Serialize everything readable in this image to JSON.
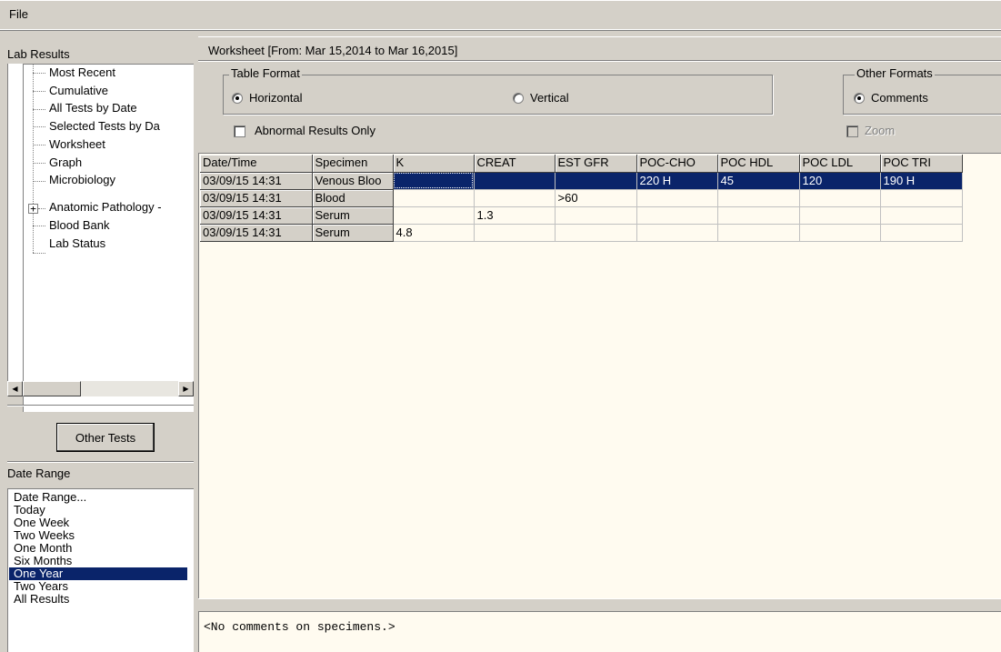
{
  "menu": {
    "file": "File"
  },
  "left": {
    "lab_results_title": "Lab Results",
    "tree": [
      {
        "label": "Most Recent"
      },
      {
        "label": "Cumulative"
      },
      {
        "label": "All Tests by Date"
      },
      {
        "label": "Selected Tests by Da"
      },
      {
        "label": "Worksheet"
      },
      {
        "label": "Graph"
      },
      {
        "label": "Microbiology"
      },
      {
        "label": "Anatomic Pathology -"
      },
      {
        "label": "Blood Bank"
      },
      {
        "label": "Lab Status"
      }
    ],
    "other_tests_label": "Other Tests",
    "date_range_title": "Date Range",
    "date_ranges": [
      "Date Range...",
      "Today",
      "One Week",
      "Two Weeks",
      "One Month",
      "Six Months",
      "One Year",
      "Two Years",
      "All Results"
    ],
    "selected_date_range": "One Year"
  },
  "worksheet": {
    "title": "Worksheet [From: Mar 15,2014 to Mar 16,2015]",
    "table_format": {
      "label": "Table Format",
      "horizontal": "Horizontal",
      "vertical": "Vertical",
      "selected": "Horizontal"
    },
    "other_formats": {
      "label": "Other Formats",
      "comments": "Comments",
      "selected": "Comments"
    },
    "abnormal_only": {
      "label": "Abnormal Results Only",
      "checked": false
    },
    "zoom": {
      "label": "Zoom",
      "checked": false,
      "enabled": false
    }
  },
  "table": {
    "columns": [
      "Date/Time",
      "Specimen",
      "K",
      "CREAT",
      "EST GFR",
      "POC-CHO",
      "POC HDL",
      "POC LDL",
      "POC TRI"
    ],
    "rows": [
      [
        "03/09/15 14:31",
        "Venous Bloo",
        "",
        "",
        "",
        "220 H",
        "45",
        "120",
        "190 H"
      ],
      [
        "03/09/15 14:31",
        "Blood",
        "",
        "",
        ">60",
        "",
        "",
        "",
        ""
      ],
      [
        "03/09/15 14:31",
        "Serum",
        "",
        "1.3",
        "",
        "",
        "",
        "",
        ""
      ],
      [
        "03/09/15 14:31",
        "Serum",
        "4.8",
        "",
        "",
        "",
        "",
        "",
        ""
      ]
    ],
    "selected_row": 0
  },
  "comments": {
    "text": "<No comments on specimens.>"
  },
  "colors": {
    "face": "#d4d0c8",
    "selection": "#0a246a",
    "grid_bg": "#fffbf0"
  }
}
